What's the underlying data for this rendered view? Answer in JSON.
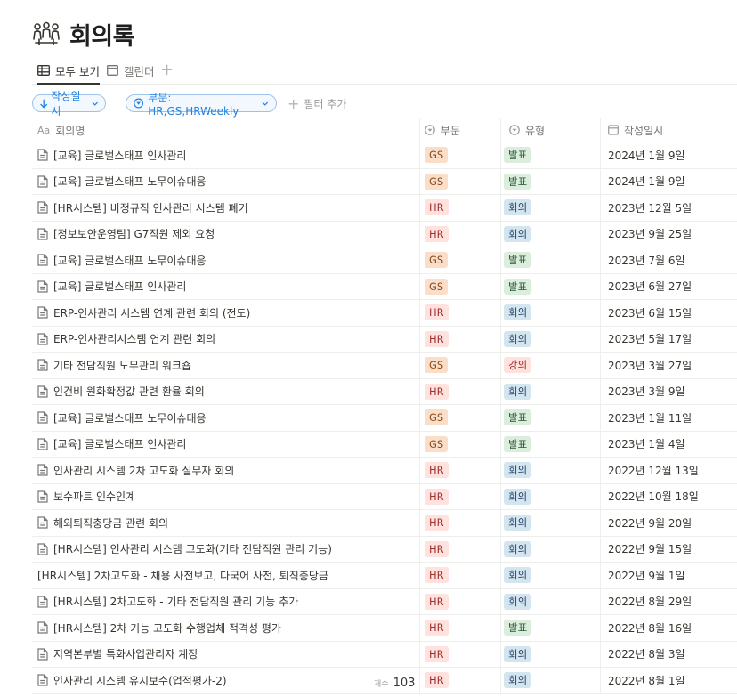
{
  "page": {
    "title": "회의록",
    "icon": "people-meeting-icon"
  },
  "views": [
    {
      "label": "모두 보기",
      "icon": "table-icon",
      "active": true
    },
    {
      "label": "캘린더",
      "icon": "calendar-icon",
      "active": false
    }
  ],
  "filters": {
    "sort_label": "작성일시",
    "dept_filter_label": "부문: HR,GS,HRWeekly",
    "add_filter_label": "필터 추가"
  },
  "columns": {
    "name": "회의명",
    "dept": "부문",
    "type": "유형",
    "date": "작성일시"
  },
  "colors": {
    "accent": "#2383e2",
    "text": "#37352f",
    "muted": "#787774"
  },
  "rows": [
    {
      "name": "[교육] 글로벌스태프 인사관리",
      "dept": "GS",
      "type": "발표",
      "date": "2024년 1월 9일",
      "has_icon": true
    },
    {
      "name": "[교육] 글로벌스태프 노무이슈대응",
      "dept": "GS",
      "type": "발표",
      "date": "2024년 1월 9일",
      "has_icon": true
    },
    {
      "name": "[HR시스템] 비정규직 인사관리 시스템 폐기",
      "dept": "HR",
      "type": "회의",
      "date": "2023년 12월 5일",
      "has_icon": true
    },
    {
      "name": "[정보보안운영팀] G7직원 제외 요청",
      "dept": "HR",
      "type": "회의",
      "date": "2023년 9월 25일",
      "has_icon": true
    },
    {
      "name": "[교육] 글로벌스태프 노무이슈대응",
      "dept": "GS",
      "type": "발표",
      "date": "2023년 7월 6일",
      "has_icon": true
    },
    {
      "name": "[교육] 글로벌스태프 인사관리",
      "dept": "GS",
      "type": "발표",
      "date": "2023년 6월 27일",
      "has_icon": true
    },
    {
      "name": "ERP-인사관리 시스템 연계 관련 회의 (전도)",
      "dept": "HR",
      "type": "회의",
      "date": "2023년 6월 15일",
      "has_icon": true
    },
    {
      "name": "ERP-인사관리시스템 연계 관련 회의",
      "dept": "HR",
      "type": "회의",
      "date": "2023년 5월 17일",
      "has_icon": true
    },
    {
      "name": "기타 전담직원 노무관리 워크숍",
      "dept": "GS",
      "type": "강의",
      "date": "2023년 3월 27일",
      "has_icon": true
    },
    {
      "name": "인건비 원화확정값 관련 환율 회의",
      "dept": "HR",
      "type": "회의",
      "date": "2023년 3월 9일",
      "has_icon": true
    },
    {
      "name": "[교육] 글로벌스태프 노무이슈대응",
      "dept": "GS",
      "type": "발표",
      "date": "2023년 1월 11일",
      "has_icon": true
    },
    {
      "name": "[교육] 글로벌스태프 인사관리",
      "dept": "GS",
      "type": "발표",
      "date": "2023년 1월 4일",
      "has_icon": true
    },
    {
      "name": "인사관리 시스템 2차 고도화 실무자 회의",
      "dept": "HR",
      "type": "회의",
      "date": "2022년 12월 13일",
      "has_icon": true
    },
    {
      "name": "보수파트 인수인계",
      "dept": "HR",
      "type": "회의",
      "date": "2022년 10월 18일",
      "has_icon": true
    },
    {
      "name": "해외퇴직충당금 관련 회의",
      "dept": "HR",
      "type": "회의",
      "date": "2022년 9월 20일",
      "has_icon": true
    },
    {
      "name": "[HR시스템] 인사관리 시스템 고도화(기타 전담직원 관리 기능)",
      "dept": "HR",
      "type": "회의",
      "date": "2022년 9월 15일",
      "has_icon": true
    },
    {
      "name": "[HR시스템] 2차고도화 - 채용 사전보고, 다국어 사전, 퇴직충당금",
      "dept": "HR",
      "type": "회의",
      "date": "2022년 9월 1일",
      "has_icon": false
    },
    {
      "name": "[HR시스템] 2차고도화 - 기타 전담직원 관리 기능 추가",
      "dept": "HR",
      "type": "회의",
      "date": "2022년 8월 29일",
      "has_icon": true
    },
    {
      "name": "[HR시스템] 2차 기능 고도화 수행업체 적격성 평가",
      "dept": "HR",
      "type": "발표",
      "date": "2022년 8월 16일",
      "has_icon": true
    },
    {
      "name": "지역본부별 특화사업관리자 계정",
      "dept": "HR",
      "type": "회의",
      "date": "2022년 8월 3일",
      "has_icon": true
    },
    {
      "name": "인사관리 시스템 유지보수(업적평가-2)",
      "dept": "HR",
      "type": "회의",
      "date": "2022년 8월 1일",
      "has_icon": true
    }
  ],
  "footer": {
    "count_label": "개수",
    "count_value": "103"
  }
}
